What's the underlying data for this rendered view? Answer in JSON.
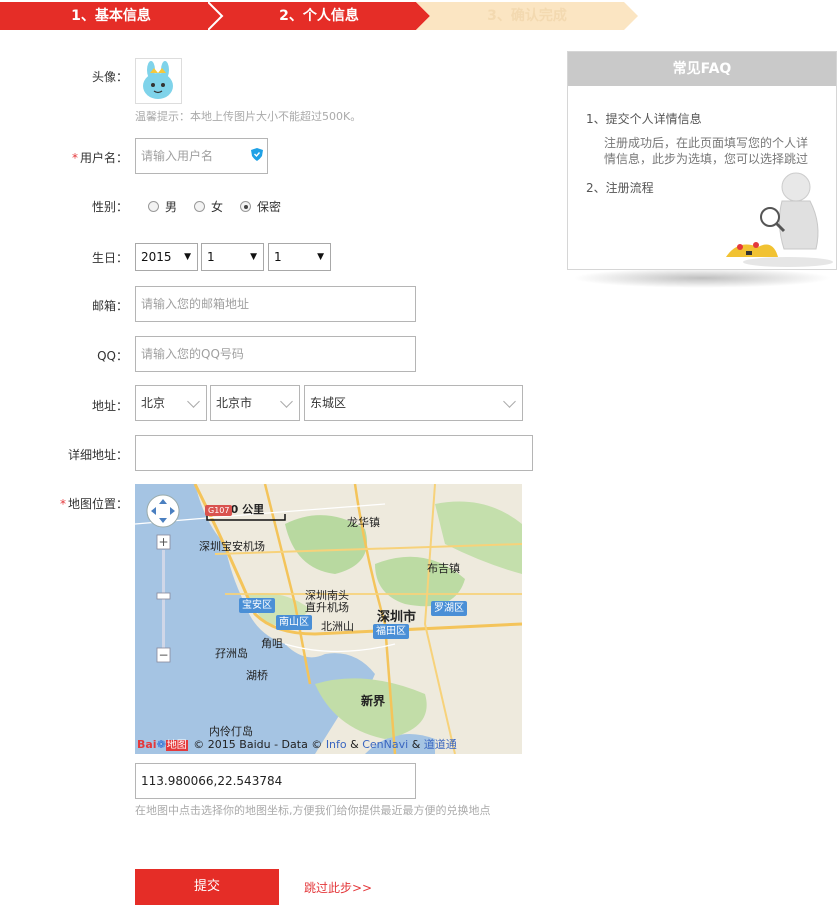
{
  "steps": [
    {
      "label": "1、基本信息"
    },
    {
      "label": "2、个人信息"
    },
    {
      "label": "3、确认完成"
    }
  ],
  "form": {
    "avatar_label": "头像：",
    "avatar_tip": "温馨提示：本地上传图片大小不能超过500K。",
    "username_label": "用户名：",
    "username_placeholder": "请输入用户名",
    "gender_label": "性别：",
    "gender_options": [
      "男",
      "女",
      "保密"
    ],
    "gender_selected": "保密",
    "birthday_label": "生日：",
    "birth_year": "2015",
    "birth_month": "1",
    "birth_day": "1",
    "email_label": "邮箱：",
    "email_placeholder": "请输入您的邮箱地址",
    "qq_label": "QQ：",
    "qq_placeholder": "请输入您的QQ号码",
    "address_label": "地址：",
    "province": "北京",
    "city": "北京市",
    "district": "东城区",
    "detail_address_label": "详细地址：",
    "map_label": "地图位置：",
    "coordinates": "113.980066,22.543784",
    "map_tip": "在地图中点击选择你的地图坐标,方便我们给你提供最近最方便的兑换地点",
    "submit_label": "提交",
    "skip_label": "跳过此步>>",
    "required_mark": "*"
  },
  "map": {
    "scale": "10 公里",
    "labels": [
      "龙华镇",
      "深圳宝安机场",
      "布吉镇",
      "深圳南头直升机场",
      "深圳市",
      "宝安区",
      "罗湖区",
      "南山区",
      "北洲山",
      "福田区",
      "角咀",
      "孖洲岛",
      "湖桥",
      "新界",
      "内伶仃岛"
    ],
    "road_shields": [
      "G107"
    ],
    "copyright_prefix": "© 2015 Baidu - Data ©",
    "copyright_info": "Info",
    "copyright_amp1": "&",
    "copyright_cennavi": "CenNavi",
    "copyright_amp2": "&",
    "copyright_daodao": "道道通",
    "logo_text": "Bai",
    "logo_text2": "地图"
  },
  "faq": {
    "title": "常见FAQ",
    "item1": "1、提交个人详情信息",
    "item1_desc": "注册成功后，在此页面填写您的个人详情信息，此步为选填，您可以选择跳过",
    "item2": "2、注册流程"
  },
  "colors": {
    "brand_red": "#e52d27",
    "step_inactive": "#fbe5c2",
    "faq_header": "#c9c9c9"
  }
}
